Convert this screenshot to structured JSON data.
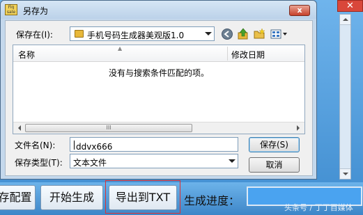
{
  "background_app": {
    "buttons": [
      {
        "label": "存配置"
      },
      {
        "label": "开始生成"
      },
      {
        "label": "导出到TXT"
      }
    ],
    "progress_label": "生成进度："
  },
  "watermark": "头条号 / 丁丁百媒体",
  "dialog": {
    "title": "另存为",
    "app_icon_text": "Fiq sale",
    "close_label": "x",
    "save_in_label": "保存在(I):",
    "save_in_value": "手机号码生成器美观版1.0",
    "list_headers": [
      "名称",
      "修改日期"
    ],
    "empty_message": "没有与搜索条件匹配的项。",
    "scroll_thumb_grip": "III",
    "filename_label": "文件名(N):",
    "filename_value": "ddvx666",
    "filetype_label": "保存类型(T):",
    "filetype_value": "文本文件",
    "save_button": "保存(S)",
    "cancel_button": "取消"
  },
  "colors": {
    "dialog_frame": "#c4d8ec",
    "highlight_border": "#e03030",
    "progress_fill": "#4aa3f0"
  }
}
